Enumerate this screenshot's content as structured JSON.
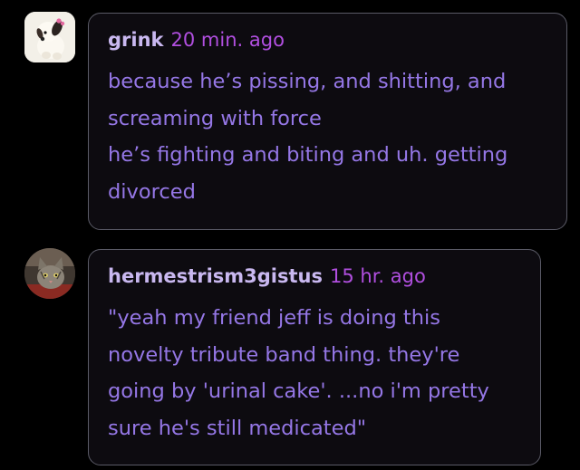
{
  "replies": [
    {
      "avatar_icon": "plush-dog-avatar",
      "username": "grink",
      "timestamp": "20 min. ago",
      "lines": [
        "because he’s pissing, and shitting, and",
        "screaming with force",
        "he’s fighting and biting and uh. getting",
        "divorced"
      ]
    },
    {
      "avatar_icon": "cat-avatar",
      "username": "hermestrism3gistus",
      "timestamp": "15 hr. ago",
      "lines": [
        "\"yeah my friend jeff is doing this",
        "novelty tribute band thing. they're",
        "going by 'urinal cake'. ...no i'm pretty",
        "sure he's still medicated\""
      ]
    }
  ],
  "colors": {
    "background": "#000000",
    "bubble_border": "#5a5a66",
    "username": "#c9b8f0",
    "timestamp": "#b14fe0",
    "body_text": "#9577e6"
  }
}
